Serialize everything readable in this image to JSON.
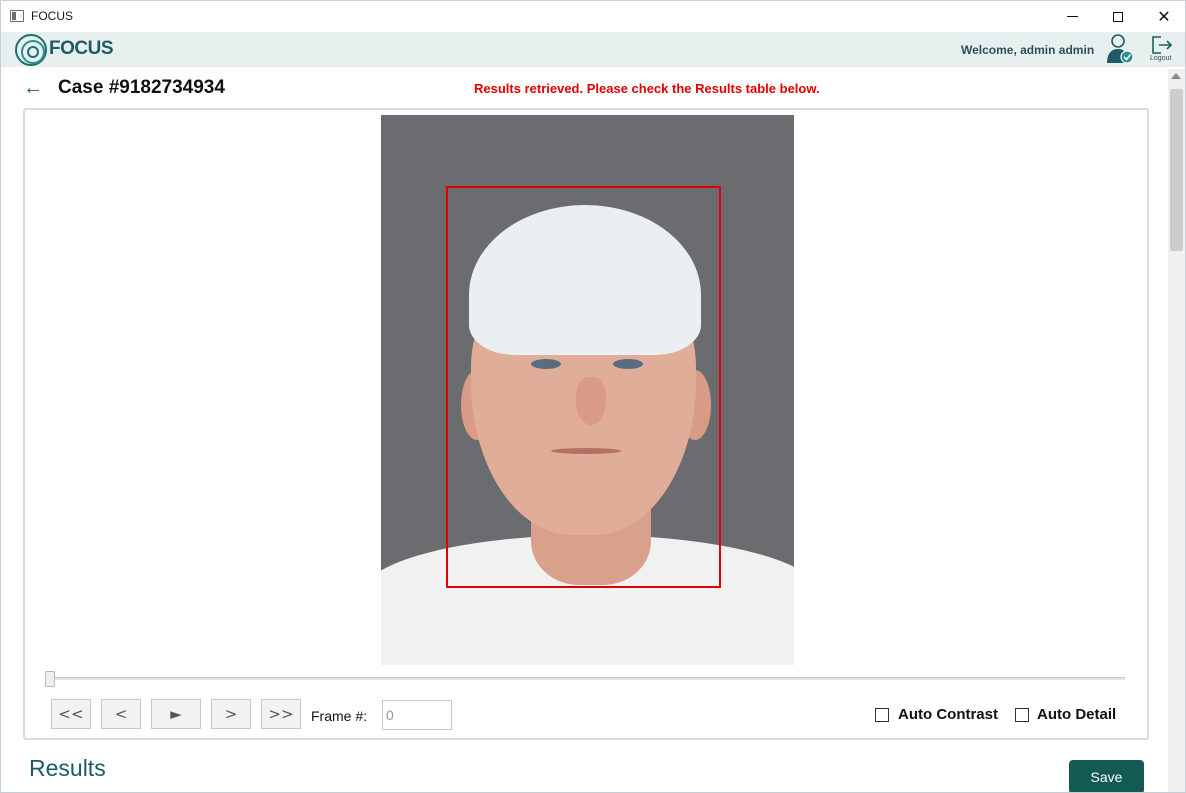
{
  "window": {
    "title": "FOCUS",
    "minimize_icon": "minimize-icon",
    "maximize_icon": "maximize-icon",
    "close_glyph": "✕"
  },
  "header": {
    "logo_text": "FOCUS",
    "welcome": "Welcome, admin admin",
    "user_icon": "user-verified-icon",
    "logout_label": "Logout"
  },
  "case": {
    "back_glyph": "←",
    "title": "Case #9182734934",
    "status_message": "Results retrieved. Please check the Results table below.",
    "status_color": "#e00000"
  },
  "viewer": {
    "image": "mugshot-photo",
    "detection_box_color": "#e00000",
    "timeline_position": 0
  },
  "controls": {
    "first": "<<",
    "prev": "<",
    "play": "►",
    "next": ">",
    "last": ">>",
    "frame_label": "Frame #:",
    "frame_value": "0",
    "auto_contrast": "Auto Contrast",
    "auto_detail": "Auto Detail",
    "auto_contrast_checked": false,
    "auto_detail_checked": false
  },
  "results": {
    "title": "Results",
    "save_label": "Save",
    "save_color": "#135a52"
  },
  "colors": {
    "brand": "#1d5c66",
    "header_bg": "#e7f0ee"
  }
}
